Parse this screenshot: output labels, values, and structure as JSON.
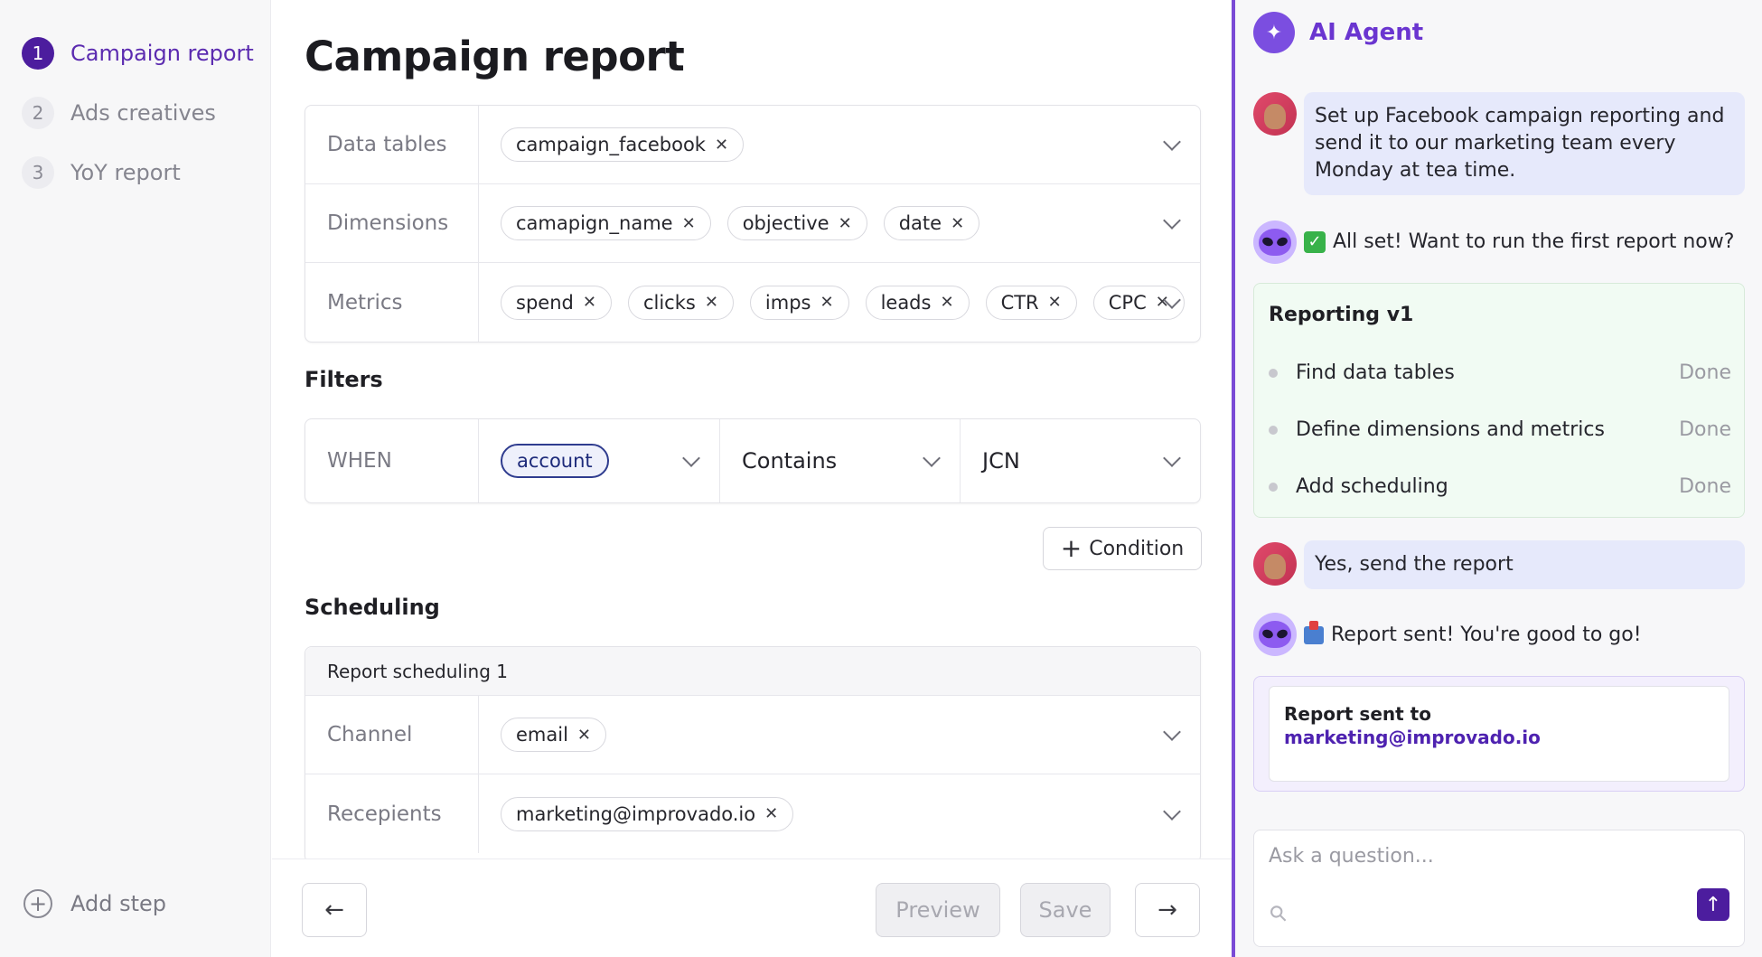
{
  "steps": [
    {
      "num": "1",
      "label": "Campaign report"
    },
    {
      "num": "2",
      "label": "Ads creatives"
    },
    {
      "num": "3",
      "label": "YoY report"
    }
  ],
  "add_step": "Add step",
  "page_title": "Campaign report",
  "data_config": {
    "data_tables": {
      "label": "Data tables",
      "chips": [
        "campaign_facebook"
      ]
    },
    "dimensions": {
      "label": "Dimensions",
      "chips": [
        "camapign_name",
        "objective",
        "date"
      ]
    },
    "metrics": {
      "label": "Metrics",
      "chips": [
        "spend",
        "clicks",
        "imps",
        "leads",
        "CTR",
        "CPC"
      ]
    }
  },
  "filters": {
    "title": "Filters",
    "when_label": "WHEN",
    "field": "account",
    "operator": "Contains",
    "value": "JCN",
    "add_condition": "Condition"
  },
  "scheduling": {
    "title": "Scheduling",
    "header": "Report scheduling 1",
    "channel": {
      "label": "Channel",
      "chips": [
        "email"
      ]
    },
    "recipients": {
      "label": "Recepients",
      "chips": [
        "marketing@improvado.io"
      ]
    }
  },
  "bottom": {
    "back": "←",
    "preview": "Preview",
    "save": "Save",
    "next": "→"
  },
  "agent": {
    "title": "AI Agent",
    "messages": {
      "user1": "Set up Facebook campaign reporting and send it to our marketing team every Monday at tea time.",
      "bot1": "All set! Want to run the first report now?",
      "user2": "Yes, send the report",
      "bot2": "Report sent! You're good to go!"
    },
    "plan": {
      "title": "Reporting v1",
      "items": [
        {
          "label": "Find data tables",
          "status": "Done"
        },
        {
          "label": "Define dimensions and metrics",
          "status": "Done"
        },
        {
          "label": "Add scheduling",
          "status": "Done"
        }
      ]
    },
    "sent": {
      "label": "Report sent to",
      "email": "marketing@improvado.io"
    },
    "ask_placeholder": "Ask a question..."
  },
  "colors": {
    "accent": "#4c1d9e",
    "agent_title": "#6a35d0",
    "user_bubble": "#e6e9fb",
    "plan_bg": "#f1fbf3"
  }
}
